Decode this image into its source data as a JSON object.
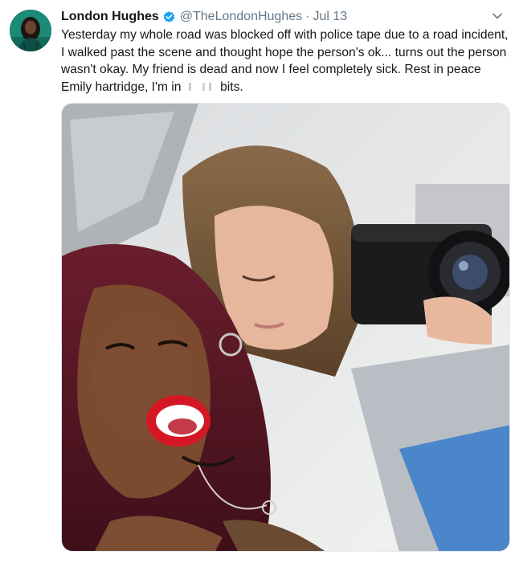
{
  "tweet": {
    "display_name": "London Hughes",
    "handle": "@TheLondonHughes",
    "separator": "·",
    "date": "Jul 13",
    "text_before_redaction": "Yesterday my whole road was blocked off with police tape due to a road incident, I walked past the scene and thought hope the person's ok... turns out the person wasn't okay. My friend is dead and now I feel completely sick. Rest in peace Emily hartridge, I'm in ",
    "text_after_redaction": " bits."
  },
  "icons": {
    "verified": "verified-badge-icon",
    "menu": "chevron-down-icon"
  },
  "colors": {
    "verified_blue": "#1da1f2",
    "text": "#14171a",
    "secondary": "#657786"
  }
}
